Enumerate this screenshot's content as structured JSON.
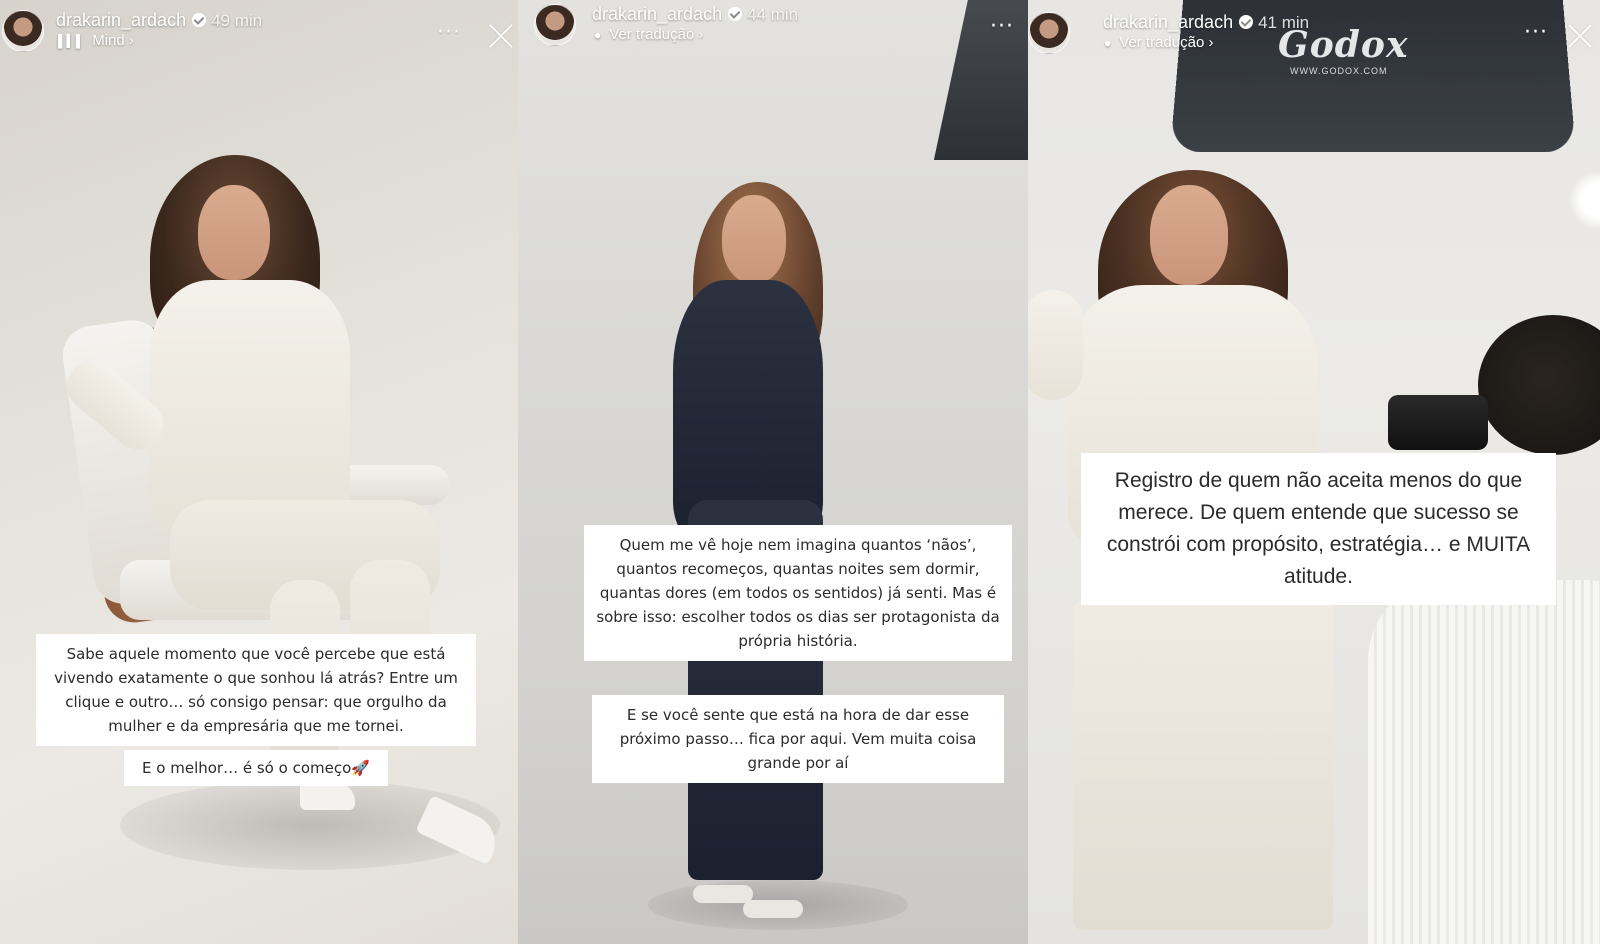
{
  "stories": [
    {
      "username": "drakarin_ardach",
      "time": "49 min",
      "sub_label": "Mind",
      "sub_icon": "music-bars-icon",
      "captions": [
        "Sabe aquele momento que você percebe que está vivendo exatamente o que sonhou lá atrás? Entre um clique e outro… só consigo pensar: que orgulho da mulher e da empresária que me tornei.",
        "E o melhor… é só o começo🚀"
      ]
    },
    {
      "username": "drakarin_ardach",
      "time": "44 min",
      "sub_label": "Ver tradução",
      "sub_icon": "translate-icon",
      "captions": [
        "Quem me vê hoje nem imagina quantos ‘nãos’, quantos recomeços, quantas noites sem dormir, quantas dores (em todos os sentidos) já senti. Mas é sobre isso: escolher todos os dias ser protagonista da própria história.",
        "E se você sente que está na hora de dar esse próximo passo… fica por aqui. Vem muita coisa grande por aí"
      ]
    },
    {
      "username": "drakarin_ardach",
      "time": "41 min",
      "sub_label": "Ver tradução",
      "sub_icon": "translate-icon",
      "captions": [
        "Registro de quem não aceita menos do que merece. De quem entende que sucesso se constrói com propósito, estratégia… e MUITA atitude."
      ],
      "brand_logo": "Godox",
      "brand_url": "WWW.GODOX.COM"
    }
  ],
  "ui": {
    "more_label": "···",
    "chevron": "›"
  }
}
